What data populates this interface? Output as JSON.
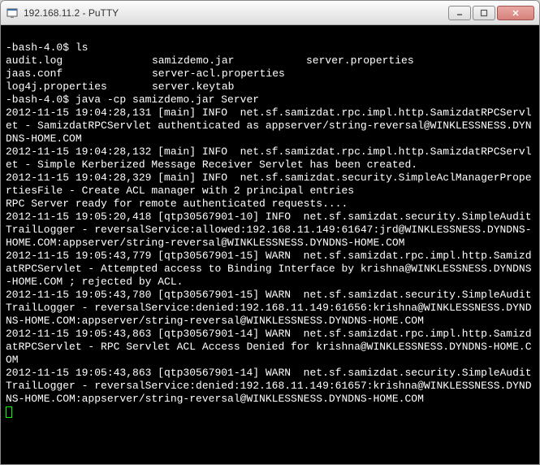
{
  "window": {
    "title": "192.168.11.2 - PuTTY"
  },
  "terminal": {
    "prompt1": "-bash-4.0$ ls",
    "ls": {
      "c1r1": "audit.log",
      "c2r1": "samizdemo.jar",
      "c3r1": "server.properties",
      "c1r2": "jaas.conf",
      "c2r2": "server-acl.properties",
      "c3r2": "",
      "c1r3": "log4j.properties",
      "c2r3": "server.keytab",
      "c3r3": ""
    },
    "prompt2": "-bash-4.0$ java -cp samizdemo.jar Server",
    "log": "2012-11-15 19:04:28,131 [main] INFO  net.sf.samizdat.rpc.impl.http.SamizdatRPCServlet - SamizdatRPCServlet authenticated as appserver/string-reversal@WINKLESSNESS.DYNDNS-HOME.COM\n2012-11-15 19:04:28,132 [main] INFO  net.sf.samizdat.rpc.impl.http.SamizdatRPCServlet - Simple Kerberized Message Receiver Servlet has been created.\n2012-11-15 19:04:28,329 [main] INFO  net.sf.samizdat.security.SimpleAclManagerPropertiesFile - Create ACL manager with 2 principal entries\nRPC Server ready for remote authenticated requests....\n2012-11-15 19:05:20,418 [qtp30567901-10] INFO  net.sf.samizdat.security.SimpleAuditTrailLogger - reversalService:allowed:192.168.11.149:61647:jrd@WINKLESSNESS.DYNDNS-HOME.COM:appserver/string-reversal@WINKLESSNESS.DYNDNS-HOME.COM\n2012-11-15 19:05:43,779 [qtp30567901-15] WARN  net.sf.samizdat.rpc.impl.http.SamizdatRPCServlet - Attempted access to Binding Interface by krishna@WINKLESSNESS.DYNDNS-HOME.COM ; rejected by ACL.\n2012-11-15 19:05:43,780 [qtp30567901-15] WARN  net.sf.samizdat.security.SimpleAuditTrailLogger - reversalService:denied:192.168.11.149:61656:krishna@WINKLESSNESS.DYNDNS-HOME.COM:appserver/string-reversal@WINKLESSNESS.DYNDNS-HOME.COM\n2012-11-15 19:05:43,863 [qtp30567901-14] WARN  net.sf.samizdat.rpc.impl.http.SamizdatRPCServlet - RPC Servlet ACL Access Denied for krishna@WINKLESSNESS.DYNDNS-HOME.COM\n2012-11-15 19:05:43,863 [qtp30567901-14] WARN  net.sf.samizdat.security.SimpleAuditTrailLogger - reversalService:denied:192.168.11.149:61657:krishna@WINKLESSNESS.DYNDNS-HOME.COM:appserver/string-reversal@WINKLESSNESS.DYNDNS-HOME.COM"
  }
}
